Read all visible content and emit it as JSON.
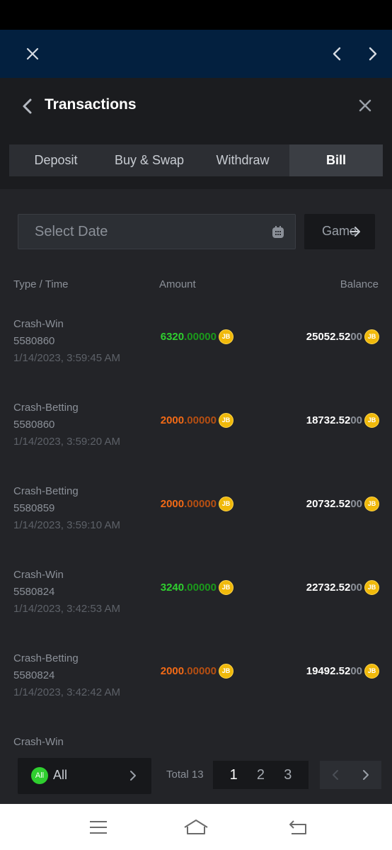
{
  "header": {
    "title": "Transactions"
  },
  "tabs": [
    {
      "label": "Deposit",
      "active": false
    },
    {
      "label": "Buy & Swap",
      "active": false
    },
    {
      "label": "Withdraw",
      "active": false
    },
    {
      "label": "Bill",
      "active": true
    }
  ],
  "filters": {
    "date_placeholder": "Select Date",
    "game_label": "Game"
  },
  "columns": {
    "type_time": "Type / Time",
    "amount": "Amount",
    "balance": "Balance"
  },
  "transactions": [
    {
      "type": "Crash-Win",
      "id": "5580860",
      "time": "1/14/2023, 3:59:45 AM",
      "amount_int": "6320",
      "amount_dec": ".00000",
      "direction": "win",
      "balance_int": "25052.52",
      "balance_dec": "00"
    },
    {
      "type": "Crash-Betting",
      "id": "5580860",
      "time": "1/14/2023, 3:59:20 AM",
      "amount_int": "2000",
      "amount_dec": ".00000",
      "direction": "loss",
      "balance_int": "18732.52",
      "balance_dec": "00"
    },
    {
      "type": "Crash-Betting",
      "id": "5580859",
      "time": "1/14/2023, 3:59:10 AM",
      "amount_int": "2000",
      "amount_dec": ".00000",
      "direction": "loss",
      "balance_int": "20732.52",
      "balance_dec": "00"
    },
    {
      "type": "Crash-Win",
      "id": "5580824",
      "time": "1/14/2023, 3:42:53 AM",
      "amount_int": "3240",
      "amount_dec": ".00000",
      "direction": "win",
      "balance_int": "22732.52",
      "balance_dec": "00"
    },
    {
      "type": "Crash-Betting",
      "id": "5580824",
      "time": "1/14/2023, 3:42:42 AM",
      "amount_int": "2000",
      "amount_dec": ".00000",
      "direction": "loss",
      "balance_int": "19492.52",
      "balance_dec": "00"
    },
    {
      "type": "Crash-Win"
    }
  ],
  "coin": {
    "symbol": "JB",
    "color": "#f0b90b"
  },
  "footer": {
    "filter_badge": "All",
    "filter_label": "All",
    "total_text": "Total 13",
    "pages": [
      "1",
      "2",
      "3"
    ],
    "current_page": "1"
  },
  "colors": {
    "win": "#2fcf2f",
    "loss": "#f26a16",
    "top_nav": "#03203f",
    "panel": "#232428"
  },
  "icons": {
    "top_nav": [
      "close-icon",
      "chevron-left-icon",
      "chevron-right-icon"
    ],
    "system_nav": [
      "menu-icon",
      "home-icon",
      "back-icon"
    ]
  }
}
